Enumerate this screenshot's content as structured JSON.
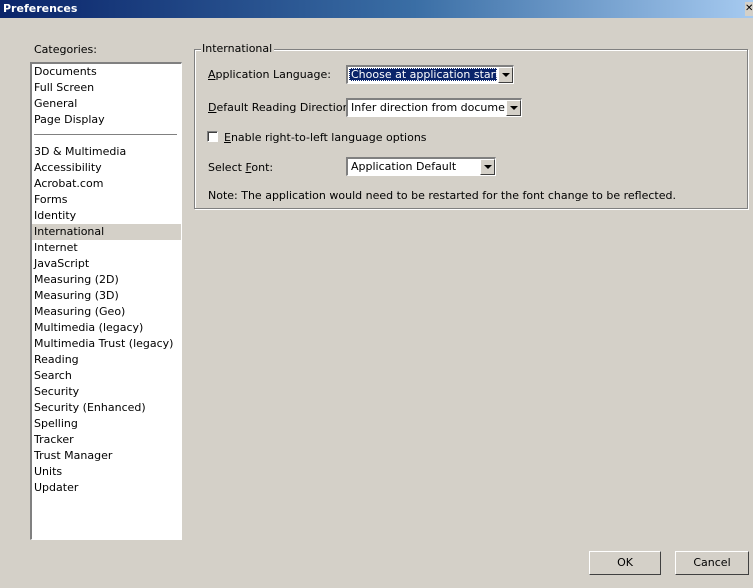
{
  "window": {
    "title": "Preferences",
    "close_glyph": "✕"
  },
  "categories": {
    "label": "Categories:",
    "group1": [
      "Documents",
      "Full Screen",
      "General",
      "Page Display"
    ],
    "group2": [
      "3D & Multimedia",
      "Accessibility",
      "Acrobat.com",
      "Forms",
      "Identity",
      "International",
      "Internet",
      "JavaScript",
      "Measuring (2D)",
      "Measuring (3D)",
      "Measuring (Geo)",
      "Multimedia (legacy)",
      "Multimedia Trust (legacy)",
      "Reading",
      "Search",
      "Security",
      "Security (Enhanced)",
      "Spelling",
      "Tracker",
      "Trust Manager",
      "Units",
      "Updater"
    ],
    "selected": "International"
  },
  "international": {
    "group_title": "International",
    "app_language": {
      "mnemonic": "A",
      "label_rest": "pplication Language:",
      "value": "Choose at application startup"
    },
    "reading_direction": {
      "mnemonic": "D",
      "label_rest": "efault Reading Direction:",
      "value": "Infer direction from document"
    },
    "rtl_checkbox": {
      "mnemonic": "E",
      "label_rest": "nable right-to-left language options",
      "checked": false
    },
    "select_font": {
      "label_prefix": "Select ",
      "mnemonic": "F",
      "label_rest": "ont:",
      "value": "Application Default"
    },
    "note": "Note: The application would need to be restarted for the font change to be reflected."
  },
  "buttons": {
    "ok": "OK",
    "cancel": "Cancel"
  }
}
